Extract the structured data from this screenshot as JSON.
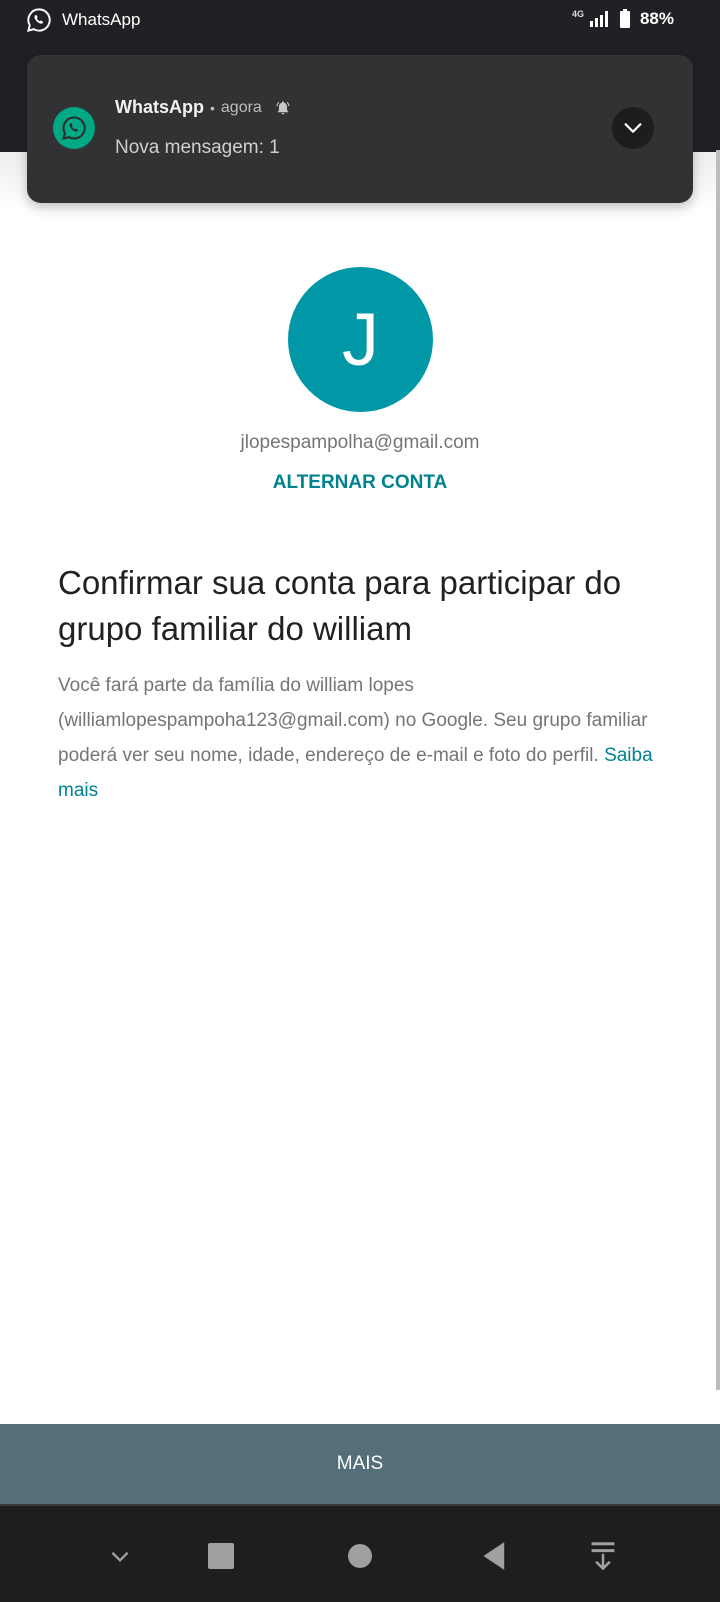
{
  "status_bar": {
    "app_name": "WhatsApp",
    "network": "4G",
    "battery": "88%"
  },
  "notification": {
    "app": "WhatsApp",
    "separator": "•",
    "time": "agora",
    "message": "Nova mensagem: 1",
    "accent_color": "#00a884"
  },
  "account": {
    "avatar_initial": "J",
    "avatar_color": "#0097a7",
    "email": "jlopespampolha@gmail.com",
    "switch_label": "ALTERNAR CONTA"
  },
  "content": {
    "heading": "Confirmar sua conta para participar do grupo familiar do william",
    "description": "Você fará parte da família do william lopes (williamlopespampoha123@gmail.com) no Google. Seu grupo familiar poderá ver seu nome, idade, endereço de e-mail e foto do perfil. ",
    "learn_more": "Saiba mais"
  },
  "footer": {
    "more_label": "MAIS"
  },
  "nav": {
    "items": [
      "collapse",
      "recents",
      "home",
      "back",
      "notifications-pull-down"
    ]
  }
}
